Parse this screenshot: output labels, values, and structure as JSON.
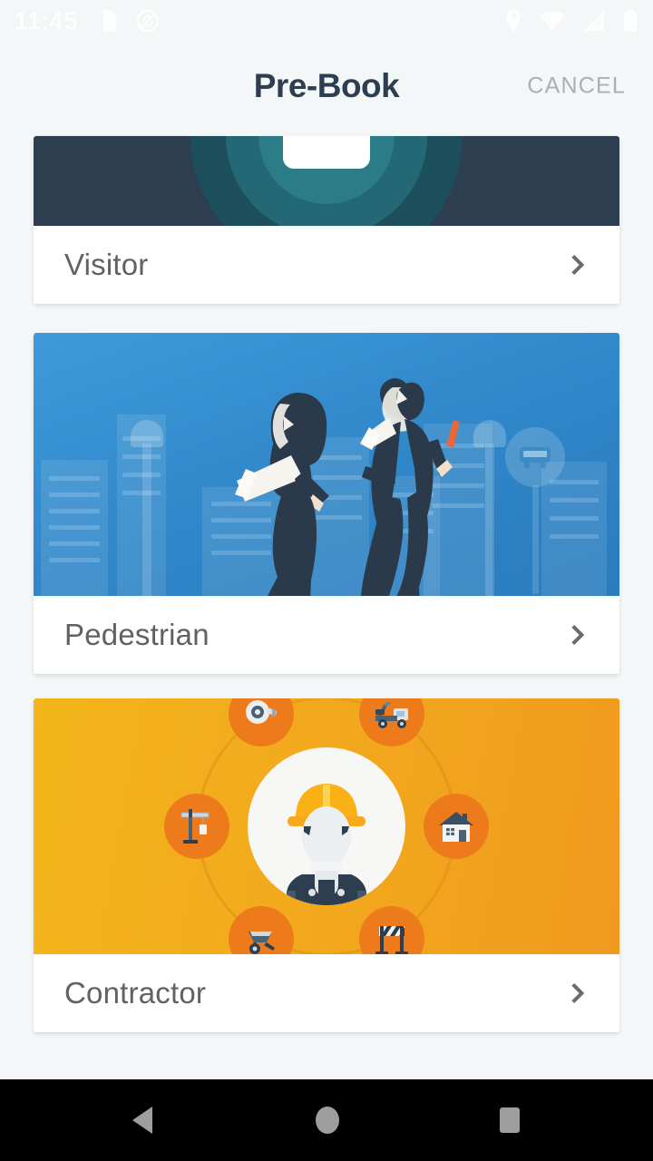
{
  "status_bar": {
    "clock": "11:45",
    "left_icons": [
      "sim-card-icon",
      "sync-disabled-icon"
    ],
    "right_icons": [
      "location-pin-icon",
      "wifi-icon",
      "cellular-signal-icon",
      "battery-icon"
    ]
  },
  "app_bar": {
    "title": "Pre-Book",
    "cancel_label": "CANCEL"
  },
  "cards": [
    {
      "label": "Visitor",
      "artwork": "visitor-badge-illustration",
      "chevron": "chevron-right-icon",
      "bg_color": "#2d3e50"
    },
    {
      "label": "Pedestrian",
      "artwork": "two-pedestrians-city-illustration",
      "chevron": "chevron-right-icon",
      "bg_color": "#3793d4"
    },
    {
      "label": "Contractor",
      "artwork": "construction-worker-icons-illustration",
      "chevron": "chevron-right-icon",
      "bg_color": "#f2ab1d"
    }
  ],
  "contractor_icons": [
    "tape-measure-icon",
    "tow-truck-icon",
    "house-icon",
    "road-barrier-icon",
    "wheelbarrow-icon",
    "crane-icon"
  ],
  "nav_bar": {
    "back": "back-triangle-icon",
    "home": "home-circle-icon",
    "recents": "recents-square-icon"
  },
  "colors": {
    "page_background": "#f4f7f8",
    "title": "#2d3e50",
    "cancel": "#a9b0b5",
    "card_label": "#616161",
    "chevron": "#6b6b6b",
    "nav_background": "#000000",
    "nav_icon": "#9e9e9e"
  }
}
